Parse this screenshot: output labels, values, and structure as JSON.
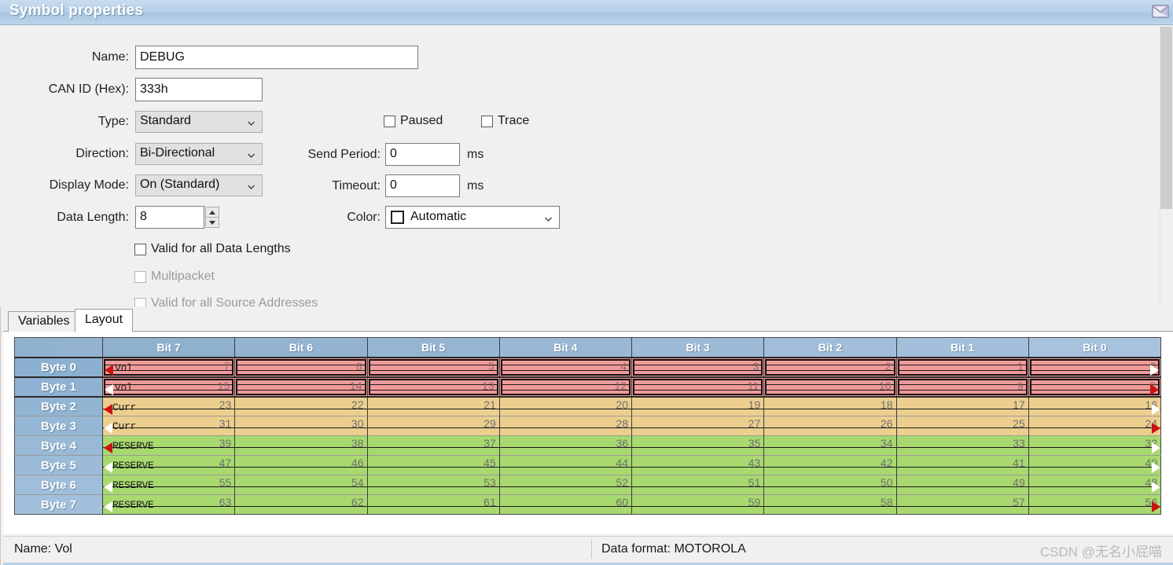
{
  "window": {
    "title": "Symbol properties",
    "icon": "envelope-icon"
  },
  "properties": {
    "name": {
      "label": "Name:",
      "value": "DEBUG"
    },
    "can_id": {
      "label": "CAN ID (Hex):",
      "value": "333h"
    },
    "type": {
      "label": "Type:",
      "value": "Standard"
    },
    "direction": {
      "label": "Direction:",
      "value": "Bi-Directional"
    },
    "display_mode": {
      "label": "Display Mode:",
      "value": "On (Standard)"
    },
    "data_length": {
      "label": "Data Length:",
      "value": "8"
    },
    "send_period": {
      "label": "Send Period:",
      "value": "0",
      "unit": "ms"
    },
    "timeout": {
      "label": "Timeout:",
      "value": "0",
      "unit": "ms"
    },
    "color": {
      "label": "Color:",
      "value": "Automatic"
    },
    "paused": {
      "label": "Paused",
      "checked": false
    },
    "trace": {
      "label": "Trace",
      "checked": false
    },
    "valid_all_data_lengths": {
      "label": "Valid for all Data Lengths",
      "checked": false
    },
    "multipacket": {
      "label": "Multipacket",
      "checked": false,
      "disabled": true
    },
    "valid_all_source_addresses": {
      "label": "Valid for all Source Addresses",
      "checked": false,
      "disabled": true
    }
  },
  "tabs": [
    {
      "label": "Variables",
      "active": false
    },
    {
      "label": "Layout",
      "active": true
    }
  ],
  "layout_grid": {
    "corner_label": "",
    "bit_headers": [
      "Bit 7",
      "Bit 6",
      "Bit 5",
      "Bit 4",
      "Bit 3",
      "Bit 2",
      "Bit 1",
      "Bit 0"
    ],
    "rows": [
      {
        "byte_label": "Byte 0",
        "signal": "Vol",
        "color": "#f29a9a",
        "selected": true,
        "start_arrow": "solid",
        "end_arrow": "hollow",
        "bits": [
          "7",
          "6",
          "5",
          "4",
          "3",
          "2",
          "1",
          "0"
        ]
      },
      {
        "byte_label": "Byte 1",
        "signal": "Vol",
        "color": "#f29a9a",
        "selected": true,
        "start_arrow": "hollow",
        "end_arrow": "solid",
        "bits": [
          "15",
          "14",
          "13",
          "12",
          "11",
          "10",
          "9",
          "8"
        ]
      },
      {
        "byte_label": "Byte 2",
        "signal": "Curr",
        "color": "#eccf8e",
        "selected": false,
        "start_arrow": "solid",
        "end_arrow": "hollow",
        "bits": [
          "23",
          "22",
          "21",
          "20",
          "19",
          "18",
          "17",
          "16"
        ]
      },
      {
        "byte_label": "Byte 3",
        "signal": "Curr",
        "color": "#eccf8e",
        "selected": false,
        "start_arrow": "hollow",
        "end_arrow": "solid",
        "bits": [
          "31",
          "30",
          "29",
          "28",
          "27",
          "26",
          "25",
          "24"
        ]
      },
      {
        "byte_label": "Byte 4",
        "signal": "RESERVE",
        "color": "#a8d96f",
        "selected": false,
        "start_arrow": "solid",
        "end_arrow": "hollow",
        "bits": [
          "39",
          "38",
          "37",
          "36",
          "35",
          "34",
          "33",
          "32"
        ]
      },
      {
        "byte_label": "Byte 5",
        "signal": "RESERVE",
        "color": "#a8d96f",
        "selected": false,
        "start_arrow": "hollow",
        "end_arrow": "hollow",
        "bits": [
          "47",
          "46",
          "45",
          "44",
          "43",
          "42",
          "41",
          "40"
        ]
      },
      {
        "byte_label": "Byte 6",
        "signal": "RESERVE",
        "color": "#a8d96f",
        "selected": false,
        "start_arrow": "hollow",
        "end_arrow": "hollow",
        "bits": [
          "55",
          "54",
          "53",
          "52",
          "51",
          "50",
          "49",
          "48"
        ]
      },
      {
        "byte_label": "Byte 7",
        "signal": "RESERVE",
        "color": "#a8d96f",
        "selected": false,
        "start_arrow": "hollow",
        "end_arrow": "solid",
        "bits": [
          "63",
          "62",
          "61",
          "60",
          "59",
          "58",
          "57",
          "56"
        ]
      }
    ]
  },
  "status_bar": {
    "name": "Name: Vol",
    "data_format": "Data format: MOTOROLA"
  },
  "watermark": "CSDN @无名小屁喵",
  "colors": {
    "title_bar": "#b6d0e8",
    "header_blue": "#8fb0cf",
    "row_header_blue": "#94b4d2",
    "signal_red": "#f29a9a",
    "signal_orange": "#eccf8e",
    "signal_green": "#a8d96f",
    "arrow_red": "#cc1111"
  }
}
